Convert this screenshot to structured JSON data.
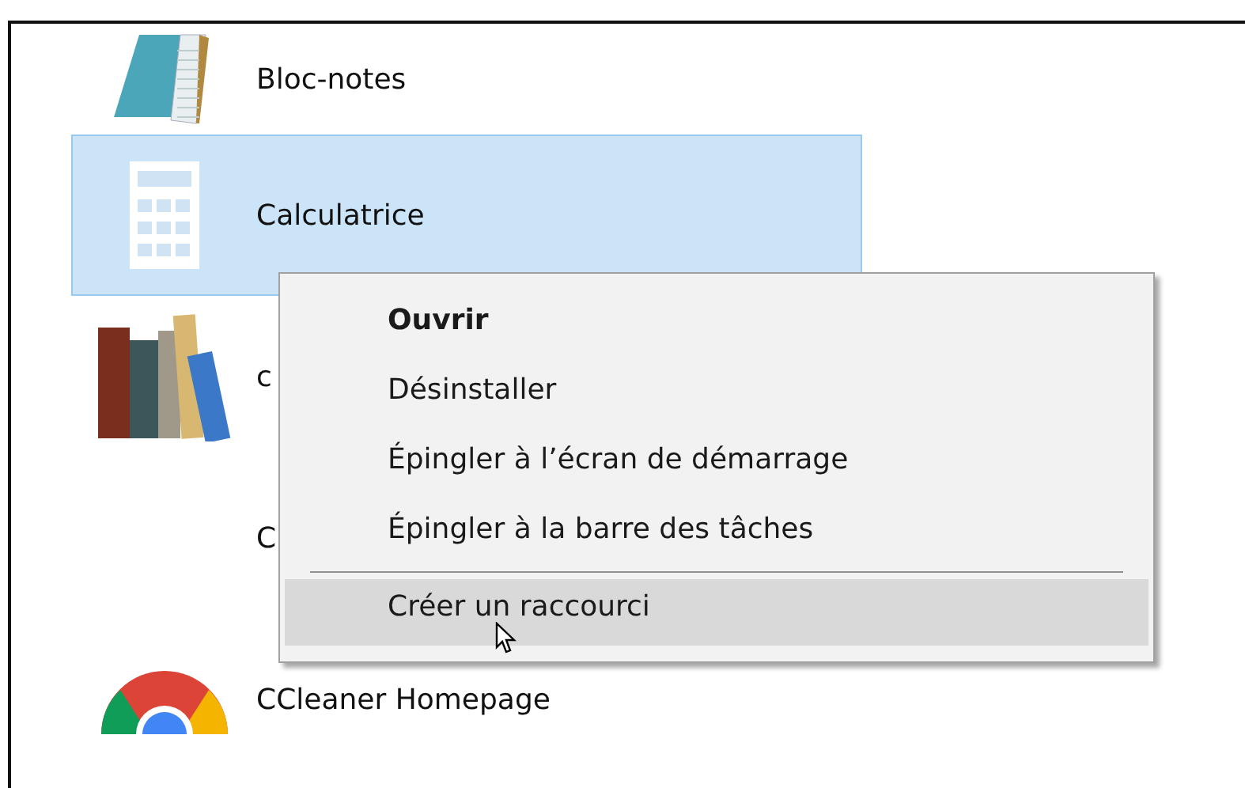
{
  "apps": [
    {
      "name": "Bloc-notes",
      "kind": "notepad",
      "selected": false
    },
    {
      "name": "Calculatrice",
      "kind": "calculator",
      "selected": true
    },
    {
      "name": "c",
      "kind": "books",
      "selected": false
    },
    {
      "name": "C",
      "kind": "blank",
      "selected": false
    },
    {
      "name": "CCleaner Homepage",
      "kind": "browser",
      "selected": false
    }
  ],
  "context_menu": {
    "items": [
      {
        "kind": "item",
        "label": "Ouvrir",
        "bold": true,
        "selected": false
      },
      {
        "kind": "item",
        "label": "Désinstaller",
        "bold": false,
        "selected": false
      },
      {
        "kind": "item",
        "label": "Épingler à l’écran de démarrage",
        "bold": false,
        "selected": false
      },
      {
        "kind": "item",
        "label": "Épingler à la barre des tâches",
        "bold": false,
        "selected": false
      },
      {
        "kind": "separator"
      },
      {
        "kind": "item",
        "label": "Créer un raccourci",
        "bold": false,
        "selected": true
      }
    ]
  }
}
